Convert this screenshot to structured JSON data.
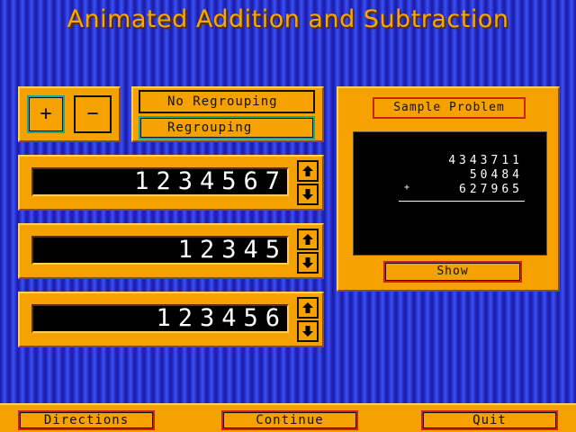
{
  "title": "Animated Addition and Subtraction",
  "operations": {
    "plus": "+",
    "minus": "−",
    "selected": "plus"
  },
  "modes": {
    "no_regrouping": "No Regrouping",
    "regrouping": "Regrouping",
    "selected": "regrouping"
  },
  "numbers": [
    {
      "value": "1234567"
    },
    {
      "value": "12345"
    },
    {
      "value": "123456"
    }
  ],
  "sample": {
    "label": "Sample Problem",
    "lines": [
      "4343711",
      "50484",
      "627965"
    ],
    "operator": "+",
    "show_label": "Show"
  },
  "footer": {
    "directions": "Directions",
    "continue": "Continue",
    "quit": "Quit"
  },
  "icons": {
    "up": "up-arrow-icon",
    "down": "down-arrow-icon"
  },
  "colors": {
    "panel": "#f5a200",
    "accent_border": "#c9241a",
    "selected_border": "#18a89a",
    "title": "#f7a800"
  }
}
